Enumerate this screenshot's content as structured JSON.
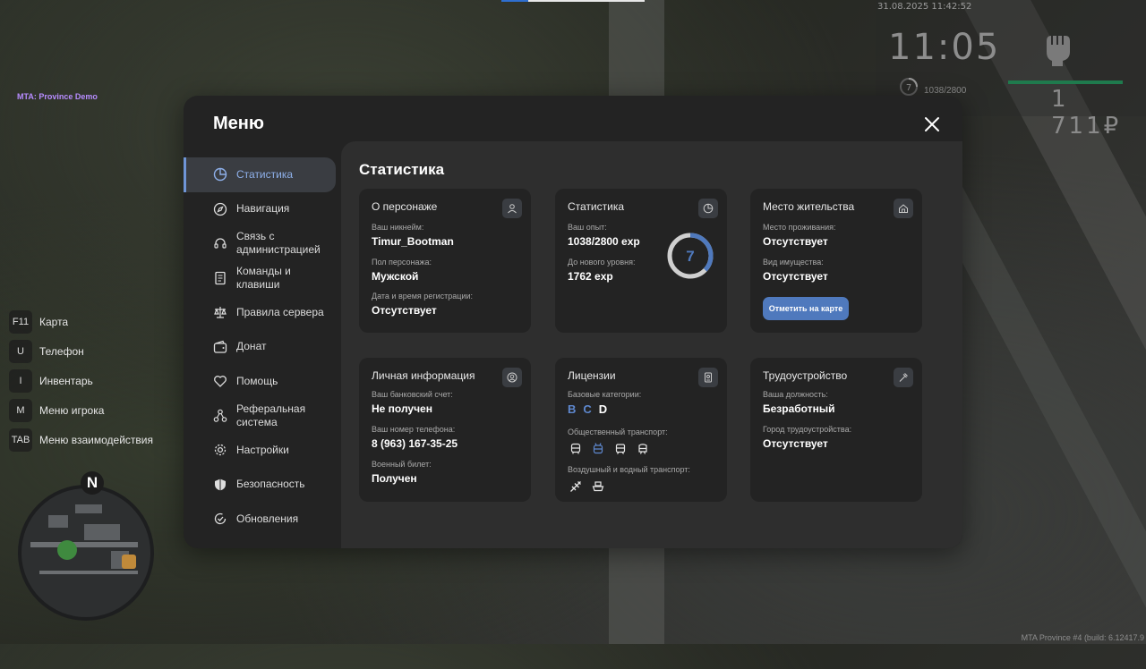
{
  "hud": {
    "server_tag": "MTA: Province Demo",
    "datetime": "31.08.2025 11:42:52",
    "time": "11:05",
    "level": "7",
    "exp": "1038/2800",
    "money": "1 711₽",
    "build": "MTA Province #4 (build: 6.12417.9"
  },
  "keybinds": [
    {
      "key": "F11",
      "label": "Карта"
    },
    {
      "key": "U",
      "label": "Телефон"
    },
    {
      "key": "I",
      "label": "Инвентарь"
    },
    {
      "key": "M",
      "label": "Меню игрока"
    },
    {
      "key": "TAB",
      "label": "Меню взаимодействия"
    }
  ],
  "minimap": {
    "compass": "N"
  },
  "menu": {
    "title": "Меню",
    "sidebar": [
      {
        "label": "Статистика",
        "icon": "pie-chart-icon",
        "active": true
      },
      {
        "label": "Навигация",
        "icon": "compass-icon"
      },
      {
        "label": "Связь с администрацией",
        "icon": "headset-icon"
      },
      {
        "label": "Команды и клавиши",
        "icon": "document-icon"
      },
      {
        "label": "Правила сервера",
        "icon": "scales-icon"
      },
      {
        "label": "Донат",
        "icon": "wallet-icon"
      },
      {
        "label": "Помощь",
        "icon": "heart-handshake-icon"
      },
      {
        "label": "Реферальная система",
        "icon": "network-icon"
      },
      {
        "label": "Настройки",
        "icon": "gear-icon"
      },
      {
        "label": "Безопасность",
        "icon": "shield-icon"
      },
      {
        "label": "Обновления",
        "icon": "update-check-icon"
      }
    ],
    "content_title": "Статистика",
    "cards": {
      "character": {
        "title": "О персонаже",
        "nickname_label": "Ваш никнейм:",
        "nickname": "Timur_Bootman",
        "gender_label": "Пол персонажа:",
        "gender": "Мужской",
        "reg_label": "Дата и время регистрации:",
        "reg": "Отсутствует"
      },
      "stats": {
        "title": "Статистика",
        "exp_label": "Ваш опыт:",
        "exp": "1038/2800 exp",
        "next_label": "До нового уровня:",
        "next": "1762 exp",
        "level": "7",
        "progress": 0.3707
      },
      "residence": {
        "title": "Место жительства",
        "place_label": "Место проживания:",
        "place": "Отсутствует",
        "property_label": "Вид имущества:",
        "property": "Отсутствует",
        "button": "Отметить на карте"
      },
      "personal": {
        "title": "Личная информация",
        "bank_label": "Ваш банковский счет:",
        "bank": "Не получен",
        "phone_label": "Ваш номер телефона:",
        "phone": "8 (963) 167-35-25",
        "military_label": "Военный билет:",
        "military": "Получен"
      },
      "licenses": {
        "title": "Лицензии",
        "base_label": "Базовые категории:",
        "categories": [
          "B",
          "C",
          "D"
        ],
        "public_label": "Общественный транспорт:",
        "air_label": "Воздушный и водный транспорт:"
      },
      "employment": {
        "title": "Трудоустройство",
        "position_label": "Ваша должность:",
        "position": "Безработный",
        "city_label": "Город трудоустройства:",
        "city": "Отсутствует"
      }
    }
  },
  "colors": {
    "accent": "#4f79bd",
    "active_text": "#8eb0ea",
    "panel": "#232323",
    "content": "#2e2e2e"
  }
}
